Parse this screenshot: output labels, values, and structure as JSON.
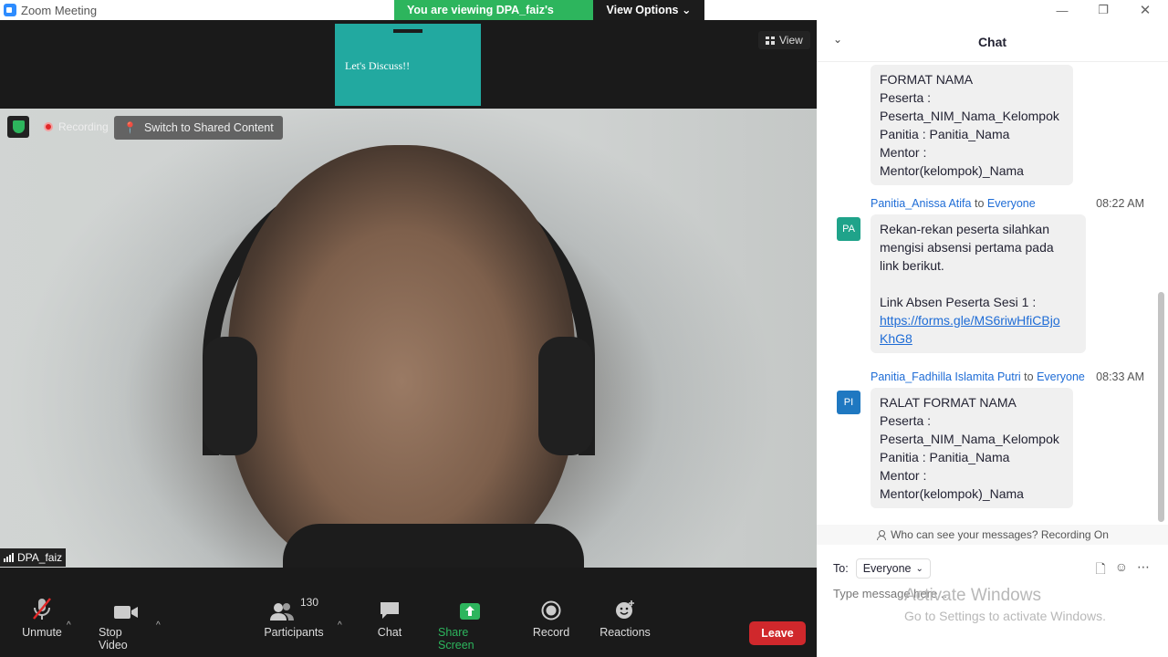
{
  "window": {
    "title": "Zoom Meeting",
    "controls": [
      "minimize-icon",
      "restore-icon",
      "close-icon"
    ]
  },
  "share_banner": {
    "status": "You are viewing DPA_faiz's screen",
    "options_label": "View Options"
  },
  "shared_thumbnail": {
    "text": "Let's Discuss!!"
  },
  "view_button": {
    "label": "View"
  },
  "video": {
    "recording_label": "Recording",
    "switch_label": "Switch to Shared Content",
    "participant_name": "DPA_faiz"
  },
  "toolbar": {
    "unmute": "Unmute",
    "stop_video": "Stop Video",
    "participants": "Participants",
    "participant_count": "130",
    "chat": "Chat",
    "share_screen": "Share Screen",
    "record": "Record",
    "reactions": "Reactions",
    "leave": "Leave"
  },
  "chat": {
    "title": "Chat",
    "messages": [
      {
        "lines": [
          "FORMAT NAMA",
          "Peserta :",
          "Peserta_NIM_Nama_Kelompok",
          "Panitia : Panitia_Nama",
          "Mentor :",
          "Mentor(kelompok)_Nama"
        ]
      },
      {
        "sender": "Panitia_Anissa Atifa",
        "to_word": "to",
        "recipient": "Everyone",
        "time": "08:22 AM",
        "initials": "PA",
        "lines": [
          "Rekan-rekan peserta silahkan",
          "mengisi absensi pertama pada",
          "link berikut.",
          "",
          "Link Absen Peserta Sesi 1 :"
        ],
        "link_lines": [
          "https://forms.gle/MS6riwHfiCBjo",
          "KhG8"
        ]
      },
      {
        "sender": "Panitia_Fadhilla Islamita Putri",
        "to_word": "to",
        "recipient": "Everyone",
        "time": "08:33 AM",
        "initials": "PI",
        "lines": [
          "RALAT FORMAT NAMA",
          "Peserta :",
          "Peserta_NIM_Nama_Kelompok",
          "Panitia : Panitia_Nama",
          "Mentor :",
          "Mentor(kelompok)_Nama"
        ]
      }
    ],
    "visibility_note": "Who can see your messages? Recording On",
    "to_label": "To:",
    "to_value": "Everyone",
    "input_placeholder": "Type message here...",
    "watermark_title": "Activate Windows",
    "watermark_sub": "Go to Settings to activate Windows."
  },
  "colors": {
    "accent": "#2d8cff",
    "share_green": "#2db55d",
    "leave_red": "#d0282c",
    "avatar_pa": "#1fa38a",
    "avatar_pi": "#1f78c1",
    "link": "#1e6cd6"
  }
}
